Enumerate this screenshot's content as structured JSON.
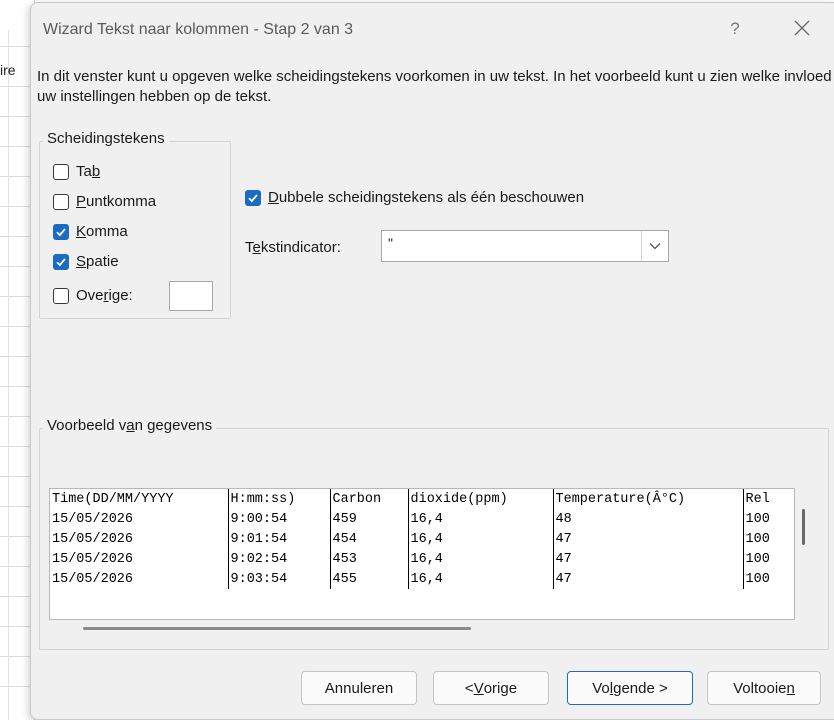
{
  "background": {
    "sheet_text": "ire"
  },
  "dialog": {
    "title": "Wizard Tekst naar kolommen - Stap 2 van 3",
    "help_label": "?",
    "intro": "In dit venster kunt u opgeven welke scheidingstekens voorkomen in uw tekst. In het voorbeeld kunt u zien welke invloed uw instellingen hebben op de tekst."
  },
  "delimiters": {
    "legend": "Scheidingstekens",
    "tab": {
      "pre": "Ta",
      "key": "b",
      "post": "",
      "checked": false
    },
    "semicolon": {
      "pre": "",
      "key": "P",
      "post": "untkomma",
      "checked": false
    },
    "comma": {
      "pre": "",
      "key": "K",
      "post": "omma",
      "checked": true
    },
    "space": {
      "pre": "",
      "key": "S",
      "post": "patie",
      "checked": true
    },
    "other": {
      "pre": "Ove",
      "key": "r",
      "post": "ige:",
      "checked": false,
      "value": ""
    }
  },
  "options": {
    "consecutive": {
      "pre": "",
      "key": "D",
      "post": "ubbele scheidingstekens als één beschouwen",
      "checked": true
    },
    "qualifier": {
      "pre": "T",
      "key": "e",
      "post": "kstindicator:",
      "value": "\""
    }
  },
  "preview": {
    "legend_pre": "Voorbeeld v",
    "legend_key": "a",
    "legend_post": "n gegevens",
    "rows": [
      [
        "Time(DD/MM/YYYY",
        "H:mm:ss)",
        "Carbon",
        "dioxide(ppm)",
        "Temperature(Â°C)",
        "Rel"
      ],
      [
        "15/05/2026",
        "9:00:54",
        "459",
        "16,4",
        "48",
        "100"
      ],
      [
        "15/05/2026",
        "9:01:54",
        "454",
        "16,4",
        "47",
        "100"
      ],
      [
        "15/05/2026",
        "9:02:54",
        "453",
        "16,4",
        "47",
        "100"
      ],
      [
        "15/05/2026",
        "9:03:54",
        "455",
        "16,4",
        "47",
        "100"
      ]
    ]
  },
  "buttons": {
    "cancel": {
      "pre": "Annuleren",
      "key": "",
      "post": ""
    },
    "back": {
      "pre": "< ",
      "key": "V",
      "post": "orige"
    },
    "next": {
      "pre": "Vo",
      "key": "l",
      "post": "gende >"
    },
    "finish": {
      "pre": "Voltooie",
      "key": "n",
      "post": ""
    }
  },
  "colors": {
    "accent": "#1a6bc4",
    "dialog_bg": "#f0f0f0"
  }
}
